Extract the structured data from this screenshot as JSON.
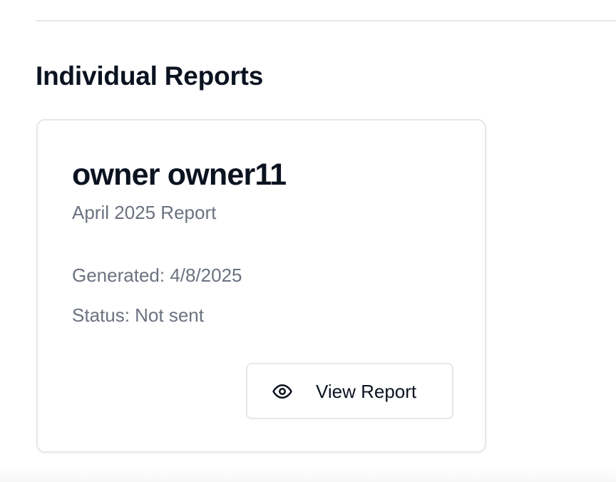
{
  "section": {
    "title": "Individual Reports"
  },
  "report_card": {
    "name": "owner owner11",
    "period": "April 2025 Report",
    "generated": "Generated: 4/8/2025",
    "status": "Status: Not sent",
    "view_button_label": "View Report",
    "view_button_icon": "eye-icon"
  },
  "colors": {
    "heading": "#0b1220",
    "muted_text": "#6b7280",
    "border": "#e5e7eb"
  }
}
